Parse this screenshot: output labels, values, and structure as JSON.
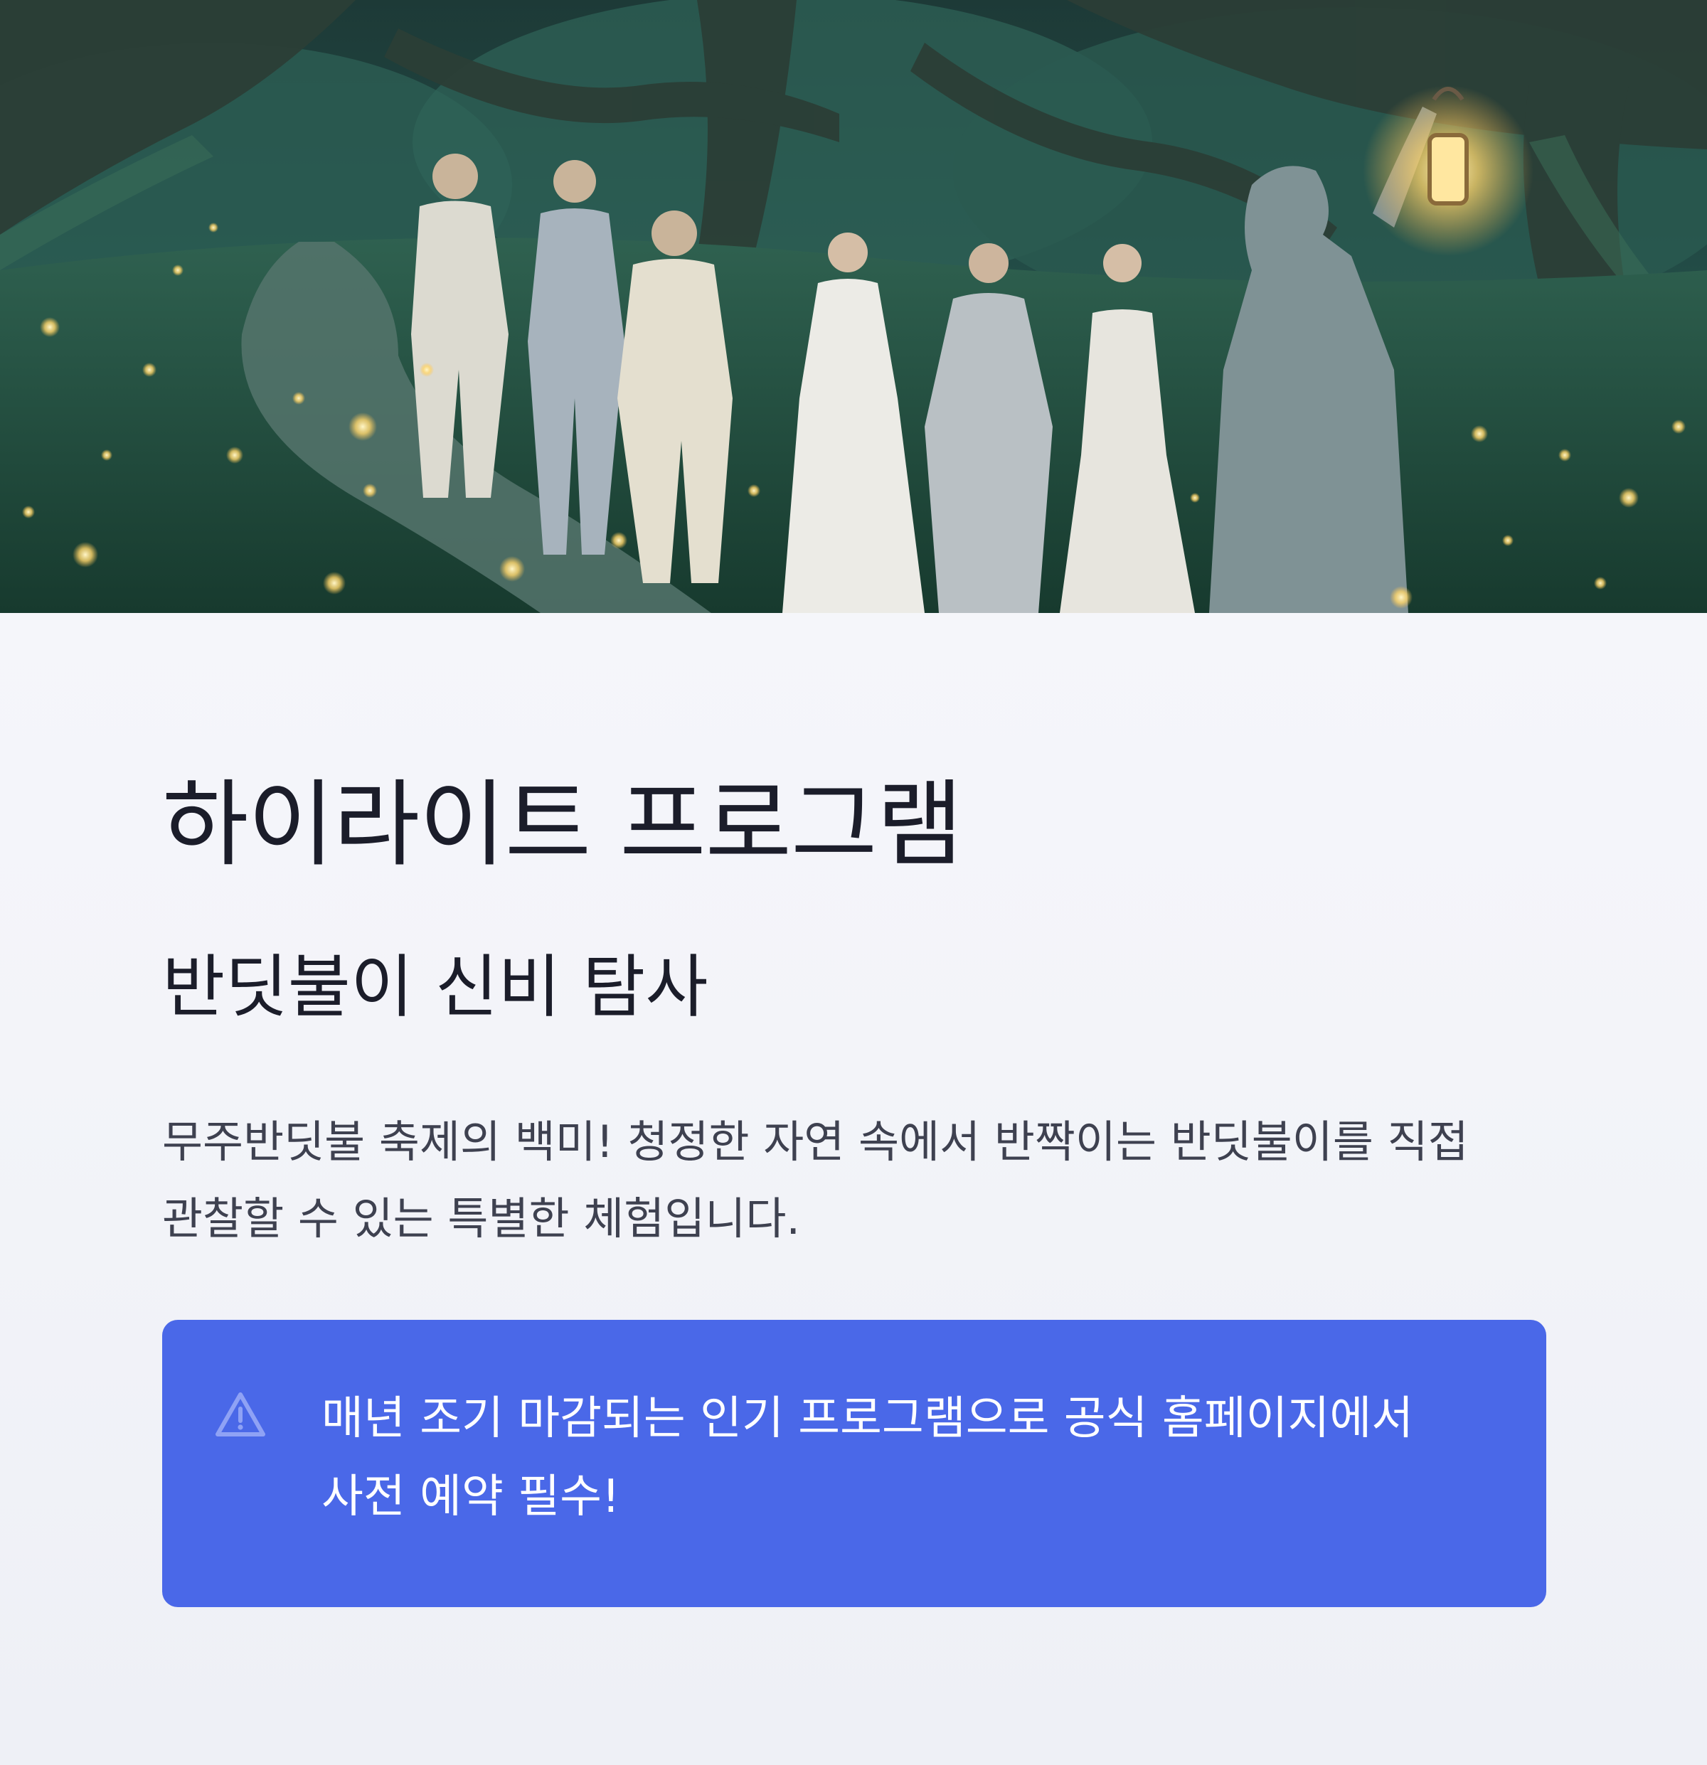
{
  "hero": {
    "alt": "",
    "accent_colors": {
      "forest": "#1f4a3f",
      "firefly": "#ffd86a",
      "lantern": "#ffcf6e"
    }
  },
  "section": {
    "title": "하이라이트 프로그램",
    "subtitle": "반딧불이 신비 탐사",
    "description": "무주반딧불 축제의 백미! 청정한 자연 속에서 반짝이는 반딧불이를 직접 관찰할 수 있는 특별한 체험입니다."
  },
  "notice": {
    "icon": "warning-triangle-icon",
    "text": "매년 조기 마감되는 인기 프로그램으로 공식 홈페이지에서 사전 예약 필수!",
    "background": "#4a68e8"
  }
}
